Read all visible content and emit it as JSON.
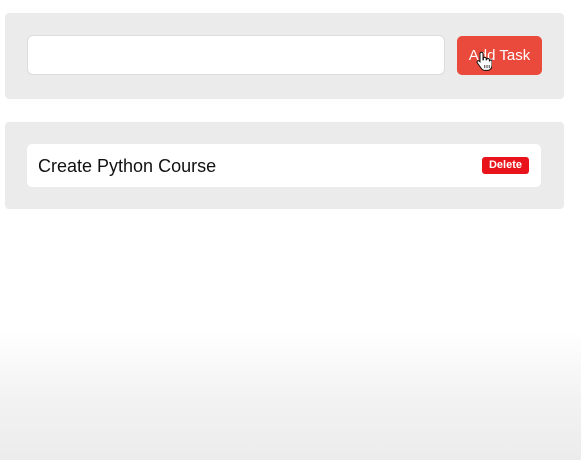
{
  "form": {
    "input_value": "",
    "input_placeholder": "",
    "add_button_label": "Add Task"
  },
  "tasks": [
    {
      "title": "Create Python Course",
      "delete_label": "Delete"
    }
  ],
  "colors": {
    "add_button": "#ea4a3b",
    "delete_button": "#e8131b",
    "panel_background": "#ebebeb"
  },
  "icons": {
    "cursor": "hand-pointer-icon"
  }
}
